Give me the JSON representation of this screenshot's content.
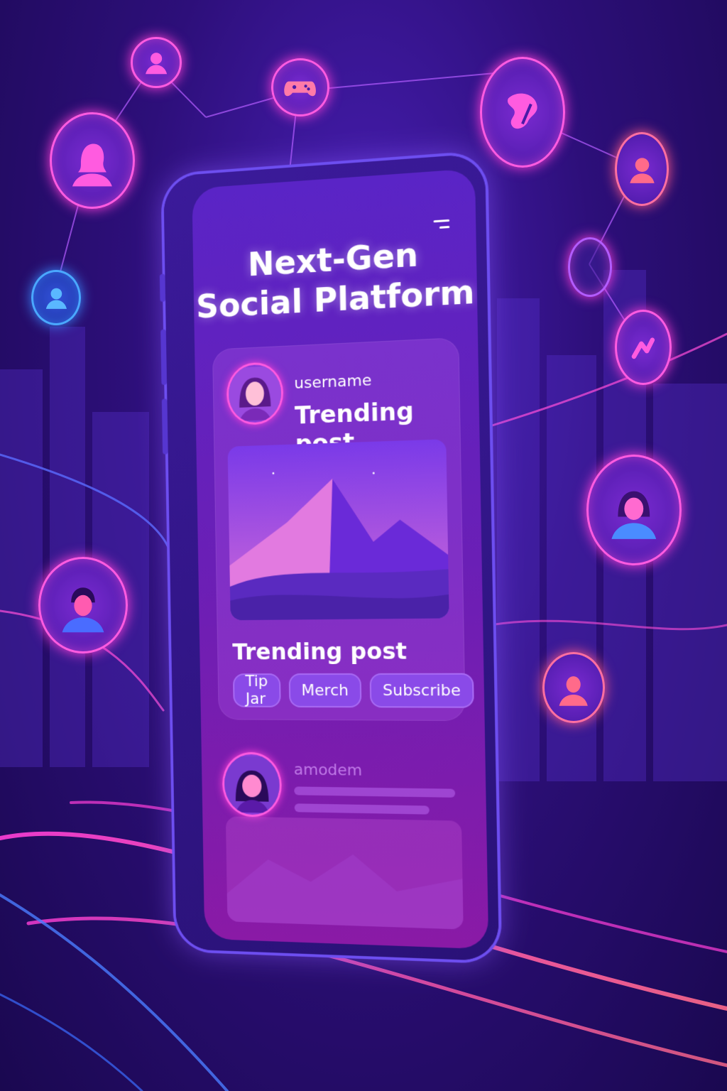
{
  "app": {
    "title_line1": "Next-Gen",
    "title_line2": "Social Platform"
  },
  "post": {
    "username": "username",
    "heading": "Trending post",
    "caption": "Trending post",
    "actions": [
      "Tip Jar",
      "Merch",
      "Subscribe"
    ]
  },
  "post2": {
    "username": "amodem"
  },
  "colors": {
    "accent": "#ff5be0",
    "button": "#8a4ae8",
    "background": "#2d0f7a"
  },
  "icons": {
    "menu": "hamburger-menu-icon",
    "avatar": "user-avatar-icon"
  }
}
